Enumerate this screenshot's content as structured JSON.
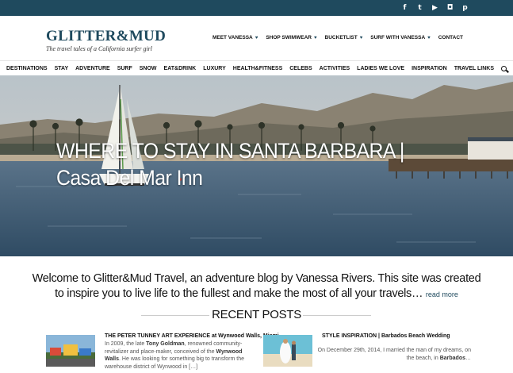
{
  "social": {
    "icons": [
      {
        "name": "facebook-icon",
        "glyph": "f"
      },
      {
        "name": "twitter-icon",
        "glyph": "t"
      },
      {
        "name": "youtube-icon",
        "glyph": "▶"
      },
      {
        "name": "instagram-icon",
        "glyph": "◘"
      },
      {
        "name": "pinterest-icon",
        "glyph": "p"
      }
    ]
  },
  "logo": {
    "name": "GLITTER&MUD",
    "tagline": "The travel tales of a California surfer girl"
  },
  "topnav": {
    "items": [
      "MEET VANESSA",
      "SHOP SWIMWEAR",
      "BUCKETLIST",
      "SURF WITH VANESSA",
      "CONTACT"
    ]
  },
  "mainnav": {
    "items": [
      "DESTINATIONS",
      "STAY",
      "ADVENTURE",
      "SURF",
      "SNOW",
      "EAT&DRINK",
      "LUXURY",
      "HEALTH&FITNESS",
      "CELEBS",
      "ACTIVITIES",
      "LADIES WE LOVE",
      "INSPIRATION",
      "TRAVEL LINKS"
    ]
  },
  "hero": {
    "title": "WHERE TO STAY IN SANTA BARBARA | Casa Del Mar Inn"
  },
  "welcome": {
    "text": "Welcome to Glitter&Mud Travel, an adventure blog by Vanessa Rivers. This site was created to inspire you to live life to the fullest and make the most of all your travels…",
    "more": "read more"
  },
  "recent": {
    "title": "RECENT POSTS",
    "posts": [
      {
        "title": "THE PETER TUNNEY ART EXPERIENCE at Wynwood Walls, Miami",
        "excerpt_parts": [
          "In 2009, the late ",
          "Tony Goldman",
          ", renowned community-revitalizer and place-maker, conceived of the ",
          "Wynwood Walls",
          ". He was looking for something big to transform the warehouse district of Wynwood in […]"
        ]
      },
      {
        "title": "STYLE INSPIRATION | Barbados Beach Wedding",
        "excerpt_parts": [
          "On December 29th, 2014, I married the man of my dreams, on the beach, in ",
          "Barbados",
          "…"
        ]
      }
    ]
  },
  "colors": {
    "brand": "#1f4a5e"
  }
}
